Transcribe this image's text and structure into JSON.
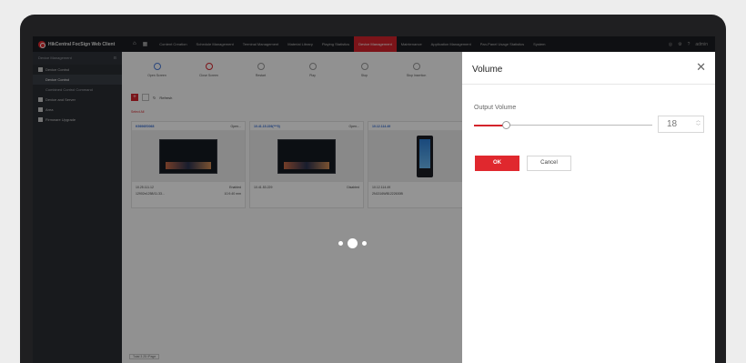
{
  "app": {
    "title": "HikCentral FocSign Web Client",
    "top_icons": [
      "home-icon",
      "grid-icon"
    ],
    "menu": [
      {
        "label": "Content Creation",
        "active": false
      },
      {
        "label": "Schedule Management",
        "active": false
      },
      {
        "label": "Terminal Management",
        "active": false
      },
      {
        "label": "Material Library",
        "active": false
      },
      {
        "label": "Playing Statistics",
        "active": false
      },
      {
        "label": "Device Management",
        "active": true
      },
      {
        "label": "Maintenance",
        "active": false
      },
      {
        "label": "Application Management",
        "active": false
      },
      {
        "label": "Pan-Panel Usage Statistics",
        "active": false
      },
      {
        "label": "System",
        "active": false
      }
    ],
    "user": "admin"
  },
  "sidebar": {
    "title": "Device Management",
    "items": [
      {
        "label": "Device Control",
        "type": "group",
        "icon": "device-icon"
      },
      {
        "label": "Device Control",
        "type": "sub",
        "active": true
      },
      {
        "label": "Combined Control Command",
        "type": "sub",
        "active": false
      },
      {
        "label": "Device and Server",
        "type": "group",
        "icon": "server-icon"
      },
      {
        "label": "Area",
        "type": "group",
        "icon": "area-icon"
      },
      {
        "label": "Firmware Upgrade",
        "type": "group",
        "icon": "upgrade-icon"
      }
    ]
  },
  "toolbar": {
    "tools": [
      {
        "label": "Open Screen",
        "icon": "power-icon"
      },
      {
        "label": "Close Screen",
        "icon": "power-off-icon"
      },
      {
        "label": "Restart",
        "icon": "restart-icon"
      },
      {
        "label": "Play",
        "icon": "play-icon"
      },
      {
        "label": "Stop",
        "icon": "stop-icon"
      },
      {
        "label": "Stop Insertion",
        "icon": "stop-insertion-icon"
      },
      {
        "label": "Clear Fil",
        "icon": "clear-icon"
      }
    ]
  },
  "actions": {
    "refresh": "Refresh",
    "select_all": "Select All"
  },
  "cards": [
    {
      "name": "K5696E0068",
      "status": "Open...",
      "ip": "10.25.111.12",
      "state": "Enabled",
      "serial": "12902e1258/11.33...",
      "size": "10.9.40 mm",
      "type": "tv"
    },
    {
      "name": "10.41.15.226(***0)",
      "status": "Open...",
      "ip": "10.41.53.229",
      "state": "Disabled",
      "serial": "",
      "size": "",
      "type": "tv"
    },
    {
      "name": "10.12.114.49",
      "status": "Open...",
      "ip": "10.12.114.49",
      "state": "Disabled",
      "serial": "2N1316WB1222630B",
      "size": "",
      "type": "kiosk"
    }
  ],
  "pagination": {
    "label": "Total 3  25 /Page"
  },
  "volume_panel": {
    "title": "Volume",
    "close_icon": "close-icon",
    "output_label": "Output Volume",
    "value": "18",
    "level": 18,
    "level_max": 100,
    "ok_label": "OK",
    "cancel_label": "Cancel"
  },
  "colors": {
    "accent": "#e0282e",
    "sidebar": "#2a2d33",
    "topbar": "#1b1d21"
  }
}
